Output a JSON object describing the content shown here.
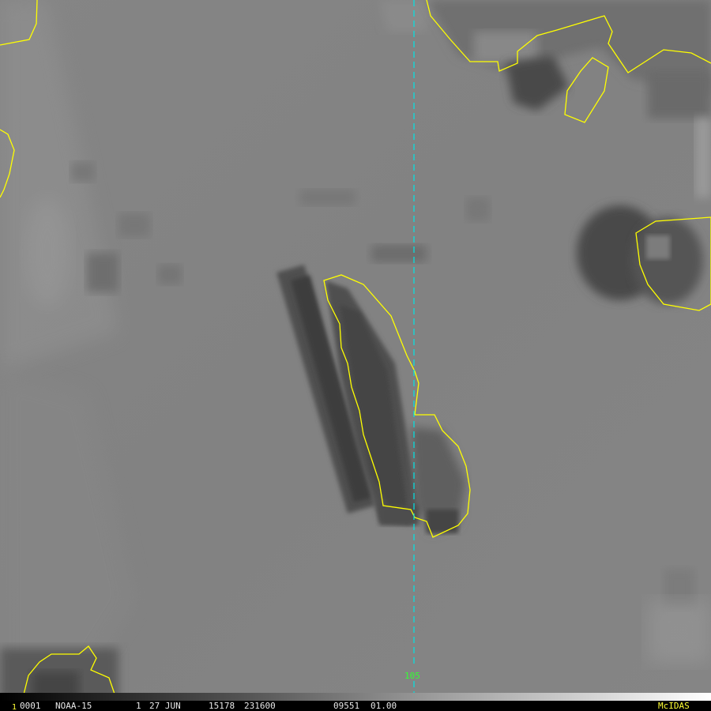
{
  "status_bar": {
    "frame_index": "1",
    "frame_id": "0001",
    "satellite": "NOAA-15",
    "band": "1",
    "date": "27 JUN",
    "julian_day": "15178",
    "time": "231600",
    "calibration": "09551",
    "calibration2": "01.00",
    "system_logo": "McIDAS"
  },
  "grid": {
    "longitude_label": "105"
  },
  "colors": {
    "background_gray": "#848484",
    "coastline": "#ffff00",
    "grid_line": "#00e5e5",
    "label_green": "#33ff33",
    "logo_yellow": "#ffff33"
  }
}
